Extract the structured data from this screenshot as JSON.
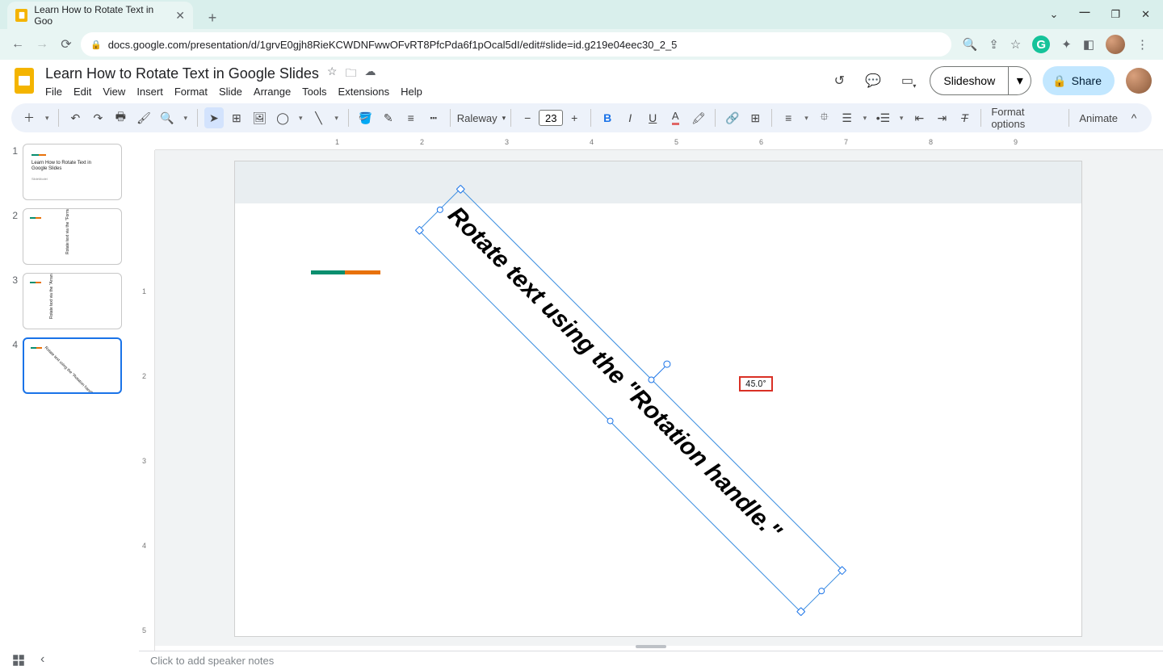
{
  "browser": {
    "tab_title": "Learn How to Rotate Text in Goo",
    "url": "docs.google.com/presentation/d/1grvE0gjh8RieKCWDNFwwOFvRT8PfcPda6f1pOcal5dI/edit#slide=id.g219e04eec30_2_5"
  },
  "app": {
    "doc_title": "Learn How to Rotate Text in Google Slides",
    "menus": [
      "File",
      "Edit",
      "View",
      "Insert",
      "Format",
      "Slide",
      "Arrange",
      "Tools",
      "Extensions",
      "Help"
    ],
    "slideshow_label": "Slideshow",
    "share_label": "Share"
  },
  "toolbar": {
    "font_family": "Raleway",
    "font_size": "23",
    "format_options": "Format options",
    "animate": "Animate"
  },
  "slides": {
    "count": 4,
    "selected": 4,
    "thumb1_title": "Learn How to Rotate Text in Google Slides",
    "thumb1_sub": "SlideModel",
    "thumb4_text": "Rotate text using the \"Rotation handle.\""
  },
  "canvas": {
    "text_content": "Rotate text using the \"Rotation handle.\"",
    "rotation_angle": "45.0°",
    "ruler_h": [
      "1",
      "2",
      "3",
      "4",
      "5",
      "6",
      "7",
      "8",
      "9"
    ],
    "ruler_v": [
      "1",
      "2",
      "3",
      "4",
      "5"
    ]
  },
  "speaker_notes_placeholder": "Click to add speaker notes"
}
